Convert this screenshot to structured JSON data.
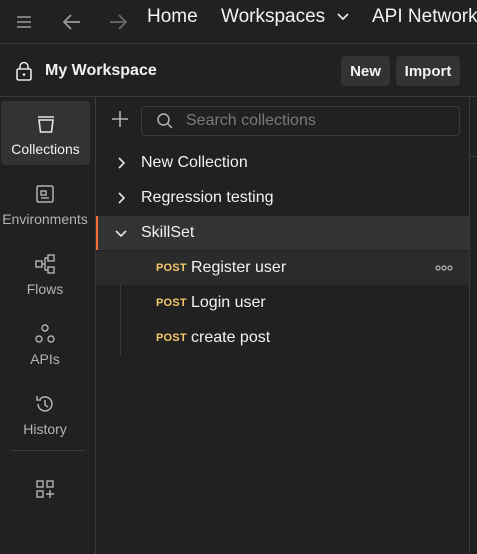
{
  "topbar": {
    "menu_icon": "hamburger-icon",
    "back_icon": "arrow-left-icon",
    "forward_icon": "arrow-right-icon",
    "home_label": "Home",
    "workspaces_label": "Workspaces",
    "api_network_label": "API Network"
  },
  "workspace": {
    "icon": "lock-icon",
    "title": "My Workspace",
    "new_label": "New",
    "import_label": "Import"
  },
  "leftnav": {
    "items": [
      {
        "label": "Collections",
        "icon": "collections-icon",
        "active": true
      },
      {
        "label": "Environments",
        "icon": "environments-icon",
        "active": false
      },
      {
        "label": "Flows",
        "icon": "flows-icon",
        "active": false
      },
      {
        "label": "APIs",
        "icon": "apis-icon",
        "active": false
      },
      {
        "label": "History",
        "icon": "history-icon",
        "active": false
      }
    ],
    "configure_icon": "add-workbench-icon"
  },
  "collections": {
    "add_icon": "plus-icon",
    "search_icon": "search-icon",
    "search_placeholder": "Search collections",
    "items": [
      {
        "label": "New Collection",
        "expanded": false
      },
      {
        "label": "Regression testing",
        "expanded": false
      },
      {
        "label": "SkillSet",
        "expanded": true,
        "selected": true,
        "requests": [
          {
            "method": "POST",
            "name": "Register user"
          },
          {
            "method": "POST",
            "name": "Login user"
          },
          {
            "method": "POST",
            "name": "create post"
          }
        ]
      }
    ]
  },
  "colors": {
    "background": "#212121",
    "selected": "#333333",
    "accent": "#ff6c37",
    "post_method": "#f5c86a"
  }
}
